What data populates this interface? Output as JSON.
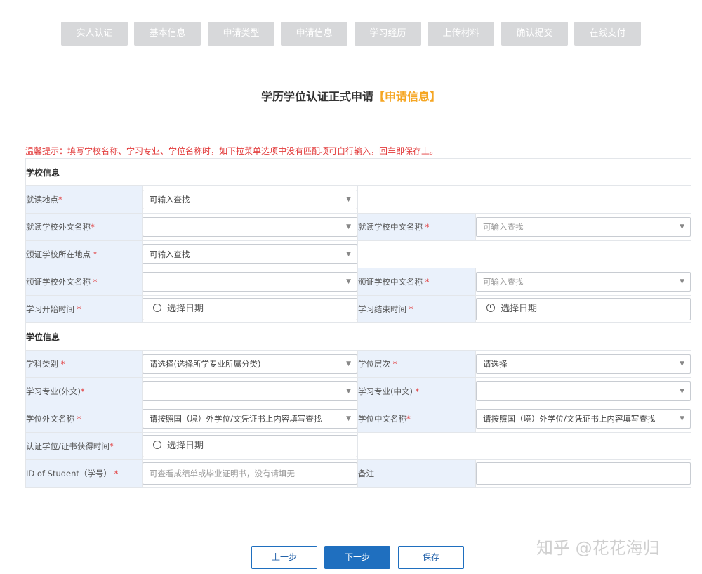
{
  "steps": [
    "实人认证",
    "基本信息",
    "申请类型",
    "申请信息",
    "学习经历",
    "上传材料",
    "确认提交",
    "在线支付"
  ],
  "page_title": {
    "main": "学历学位认证正式申请",
    "highlight": "【申请信息】"
  },
  "notice": "温馨提示：填写学校名称、学习专业、学位名称时，如下拉菜单选项中没有匹配项可自行输入，回车即保存上。",
  "sections": {
    "school": "学校信息",
    "degree": "学位信息"
  },
  "fields": {
    "study_location": {
      "label": "就读地点",
      "req": "*",
      "value": "可输入查找"
    },
    "school_foreign_name": {
      "label": "就读学校外文名称",
      "req": "*",
      "value": ""
    },
    "school_cn_name": {
      "label": "就读学校中文名称",
      "req": " *",
      "value": "可输入查找"
    },
    "issuing_school_location": {
      "label": "颁证学校所在地点",
      "req": " *",
      "value": "可输入查找"
    },
    "issuing_school_foreign_name": {
      "label": "颁证学校外文名称",
      "req": " *",
      "value": ""
    },
    "issuing_school_cn_name": {
      "label": "颁证学校中文名称",
      "req": " *",
      "value": "可输入查找"
    },
    "study_start": {
      "label": "学习开始时间",
      "req": " *",
      "value": "选择日期"
    },
    "study_end": {
      "label": "学习结束时间",
      "req": " *",
      "value": "选择日期"
    },
    "discipline": {
      "label": "学科类别",
      "req": " *",
      "value": "请选择(选择所学专业所属分类)"
    },
    "degree_level": {
      "label": "学位层次",
      "req": " *",
      "value": "请选择"
    },
    "major_foreign": {
      "label": "学习专业(外文)",
      "req": "*",
      "value": ""
    },
    "major_cn": {
      "label": "学习专业(中文)",
      "req": " *",
      "value": ""
    },
    "degree_foreign_name": {
      "label": "学位外文名称",
      "req": " *",
      "value": "请按照国（境）外学位/文凭证书上内容填写查找"
    },
    "degree_cn_name": {
      "label": "学位中文名称",
      "req": "*",
      "value": "请按照国（境）外学位/文凭证书上内容填写查找"
    },
    "degree_obtained_time": {
      "label": "认证学位/证书获得时间",
      "req": "*",
      "value": "选择日期"
    },
    "student_id": {
      "label": "ID of Student（学号）",
      "req": " *",
      "placeholder": "可查看成绩单或毕业证明书，没有请填无"
    },
    "remarks": {
      "label": "备注",
      "req": "",
      "value": ""
    }
  },
  "buttons": {
    "prev": "上一步",
    "next": "下一步",
    "save": "保存"
  },
  "watermark": "知乎 @花花海归",
  "colors": {
    "step_bg": "#d7d8da",
    "label_bg": "#eaf1fb",
    "highlight": "#f5a623",
    "notice": "#e23b3b",
    "primary": "#1f6fbf"
  }
}
